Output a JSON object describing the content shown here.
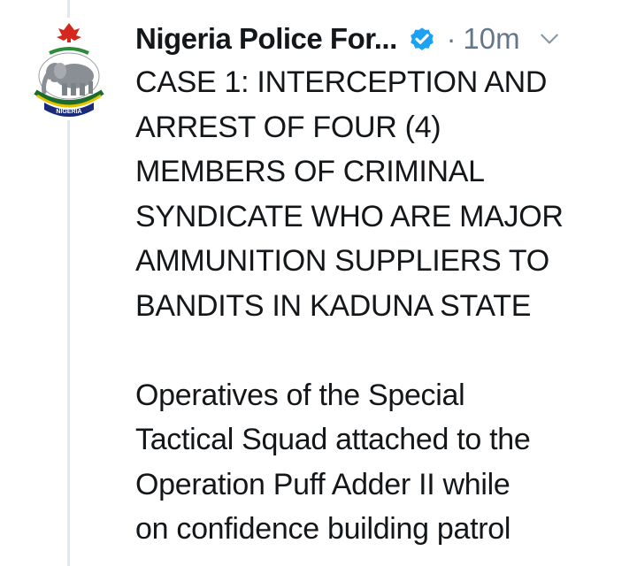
{
  "tweet": {
    "author_name": "Nigeria Police For...",
    "separator": "·",
    "timestamp": "10m",
    "avatar_text": "NIGERIA",
    "heading_lines": [
      "CASE 1: INTERCEPTION AND",
      "ARREST OF FOUR (4)",
      "MEMBERS OF CRIMINAL",
      "SYNDICATE WHO ARE MAJOR",
      "AMMUNITION SUPPLIERS TO",
      "BANDITS IN KADUNA STATE"
    ],
    "body_lines": [
      "Operatives of the Special",
      "Tactical Squad attached to the",
      "Operation Puff Adder II while",
      "on confidence building patrol"
    ]
  },
  "icons": {
    "verified": "verified-badge-icon",
    "caret": "chevron-down-icon",
    "avatar": "nigeria-police-crest"
  },
  "colors": {
    "text": "#14171a",
    "secondary": "#657786",
    "verified_blue": "#1da1f2",
    "thread_line": "#e1e8ed"
  }
}
